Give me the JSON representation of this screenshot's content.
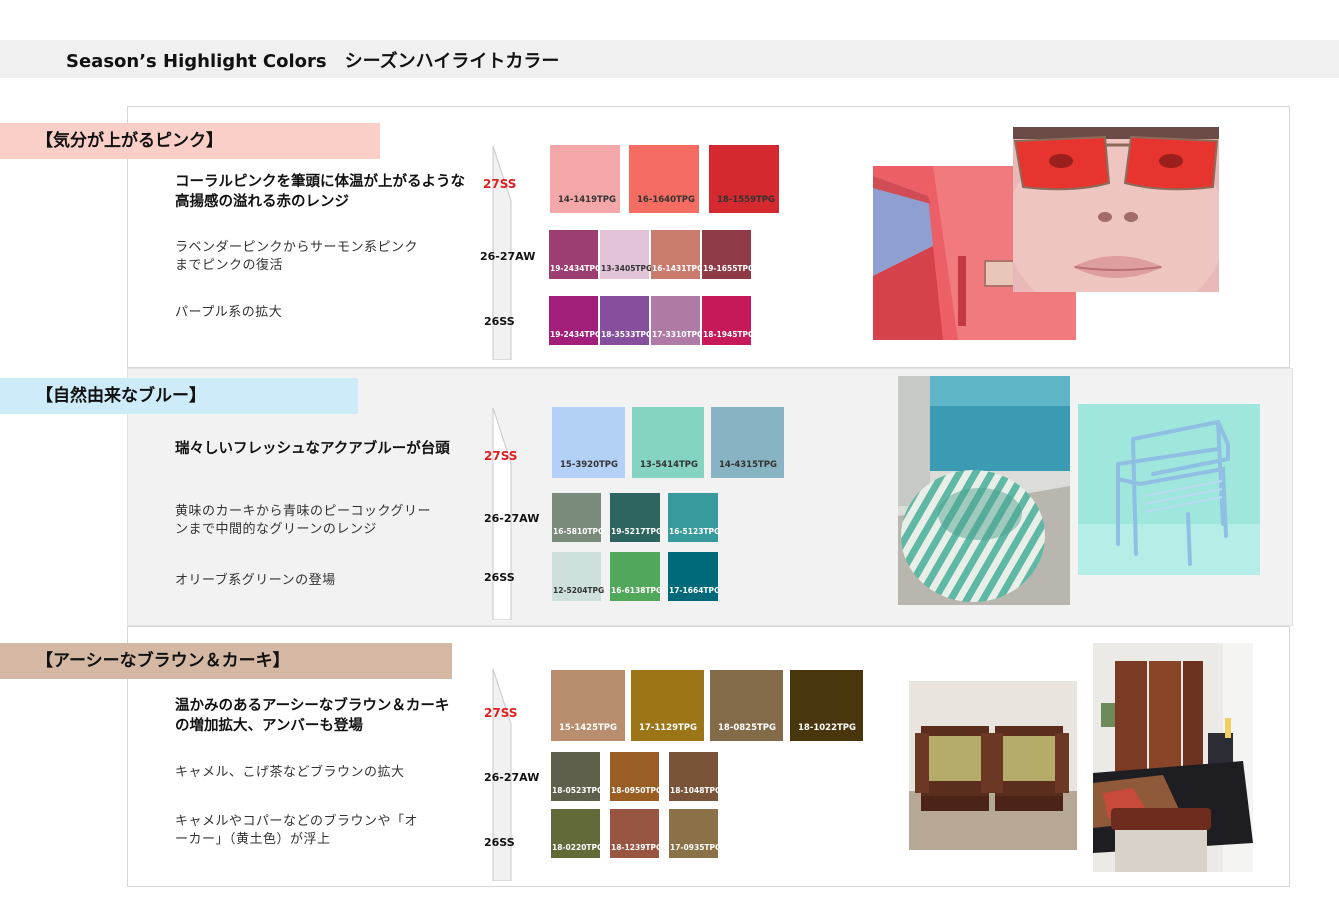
{
  "header": {
    "title": "Season’s Highlight Colors　シーズンハイライトカラー"
  },
  "sections": [
    {
      "tag": "【気分が上がるピンク】",
      "headline": "コーラルピンクを筆頭に体温が上がるような高揚感の溢れる赤のレンジ",
      "note1": "ラベンダーピンクからサーモン系ピンクまでピンクの復活",
      "note2": "パープル系の拡大",
      "season1": "27SS",
      "season2": "26-27AW",
      "season3": "26SS",
      "row1": [
        {
          "code": "14-1419TPG",
          "color": "#f4a7a9"
        },
        {
          "code": "16-1640TPG",
          "color": "#f56d62"
        },
        {
          "code": "18-1559TPG",
          "color": "#d3292f"
        }
      ],
      "row2": [
        {
          "code": "19-2434TPG",
          "color": "#9d3e72"
        },
        {
          "code": "13-3405TPG",
          "color": "#e2c3d8"
        },
        {
          "code": "16-1431TPG",
          "color": "#c97b6d"
        },
        {
          "code": "19-1655TPG",
          "color": "#8e3a47"
        }
      ],
      "row3": [
        {
          "code": "19-2434TPG",
          "color": "#a11f7a"
        },
        {
          "code": "18-3533TPG",
          "color": "#874e9e"
        },
        {
          "code": "17-3310TPG",
          "color": "#b07aa7"
        },
        {
          "code": "18-1945TPG",
          "color": "#c5195a"
        }
      ]
    },
    {
      "tag": "【自然由来なブルー】",
      "headline": "瑞々しいフレッシュなアクアブルーが台頭",
      "note1": "黄味のカーキから青味のピーコックグリーンまで中間的なグリーンのレンジ",
      "note2": "オリーブ系グリーンの登場",
      "season1": "27SS",
      "season2": "26-27AW",
      "season3": "26SS",
      "row1": [
        {
          "code": "15-3920TPG",
          "color": "#b3d0f7"
        },
        {
          "code": "13-5414TPG",
          "color": "#84d4c1"
        },
        {
          "code": "14-4315TPG",
          "color": "#87b3c3"
        }
      ],
      "row2": [
        {
          "code": "16-5810TPG",
          "color": "#7a8a7b"
        },
        {
          "code": "19-5217TPG",
          "color": "#2f6561"
        },
        {
          "code": "16-5123TPG",
          "color": "#379a9c"
        }
      ],
      "row3": [
        {
          "code": "12-5204TPG",
          "color": "#cde0dc"
        },
        {
          "code": "16-6138TPG",
          "color": "#52a85a"
        },
        {
          "code": "17-1664TPG",
          "color": "#006a7a"
        }
      ]
    },
    {
      "tag": "【アーシーなブラウン＆カーキ】",
      "headline": "温かみのあるアーシーなブラウン＆カーキの増加拡大、アンバーも登場",
      "note1": "キャメル、こげ茶などブラウンの拡大",
      "note2": "キャメルやコパーなどのブラウンや「オーカー」（黄土色）が浮上",
      "season1": "27SS",
      "season2": "26-27AW",
      "season3": "26SS",
      "row1": [
        {
          "code": "15-1425TPG",
          "color": "#b98e6e"
        },
        {
          "code": "17-1129TPG",
          "color": "#9c7519"
        },
        {
          "code": "18-0825TPG",
          "color": "#836b4a"
        },
        {
          "code": "18-1022TPG",
          "color": "#4a360c"
        }
      ],
      "row2": [
        {
          "code": "18-0523TPG",
          "color": "#5e604b"
        },
        {
          "code": "18-0950TPG",
          "color": "#9a5e24"
        },
        {
          "code": "18-1048TPG",
          "color": "#7a5439"
        }
      ],
      "row3": [
        {
          "code": "18-0220TPG",
          "color": "#636a3a"
        },
        {
          "code": "18-1239TPG",
          "color": "#985642"
        },
        {
          "code": "17-0935TPG",
          "color": "#8a7147"
        }
      ]
    }
  ],
  "colors": {
    "pink_tag": "#f9cfc7",
    "blue_tag": "#cdebf9",
    "brown_tag": "#d4b8a3",
    "season_highlight": "#e02020"
  }
}
